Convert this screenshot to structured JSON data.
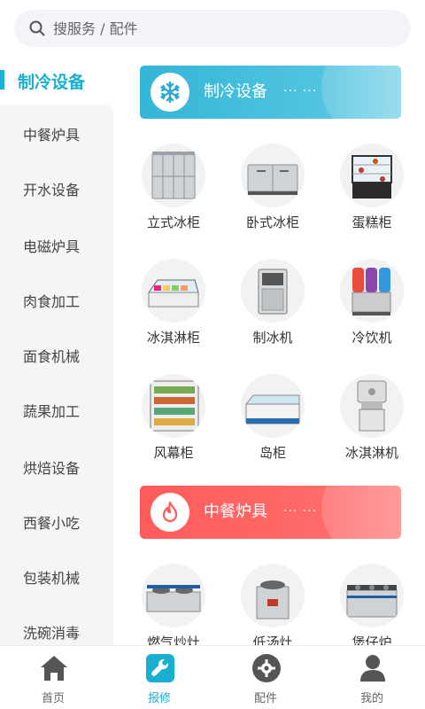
{
  "search": {
    "placeholder": "搜服务 / 配件",
    "icon": "search-icon"
  },
  "sidebar": {
    "active": "制冷设备",
    "accent_color": "#1aaed0",
    "items": [
      {
        "label": "中餐炉具"
      },
      {
        "label": "开水设备"
      },
      {
        "label": "电磁炉具"
      },
      {
        "label": "肉食加工"
      },
      {
        "label": "面食机械"
      },
      {
        "label": "蔬果加工"
      },
      {
        "label": "烘焙设备"
      },
      {
        "label": "西餐小吃"
      },
      {
        "label": "包装机械"
      },
      {
        "label": "洗碗消毒"
      }
    ]
  },
  "sections": [
    {
      "title": "制冷设备",
      "more": "··· ···",
      "icon": "snowflake-icon",
      "color": "#33b6d8",
      "products": [
        {
          "label": "立式冰柜",
          "icon": "upright-freezer-icon"
        },
        {
          "label": "卧式冰柜",
          "icon": "undercounter-freezer-icon"
        },
        {
          "label": "蛋糕柜",
          "icon": "cake-display-icon"
        },
        {
          "label": "冰淇淋柜",
          "icon": "ice-cream-display-icon"
        },
        {
          "label": "制冰机",
          "icon": "ice-maker-icon"
        },
        {
          "label": "冷饮机",
          "icon": "drink-dispenser-icon"
        },
        {
          "label": "风幕柜",
          "icon": "air-curtain-cabinet-icon"
        },
        {
          "label": "岛柜",
          "icon": "island-freezer-icon"
        },
        {
          "label": "冰淇淋机",
          "icon": "soft-serve-machine-icon"
        }
      ]
    },
    {
      "title": "中餐炉具",
      "more": "··· ···",
      "icon": "flame-icon",
      "color": "#ff5b5b",
      "products": [
        {
          "label": "燃气炒灶",
          "icon": "gas-wok-stove-icon"
        },
        {
          "label": "低汤灶",
          "icon": "soup-stove-icon"
        },
        {
          "label": "煲仔炉",
          "icon": "clay-pot-stove-icon"
        }
      ]
    }
  ],
  "tabbar": {
    "active_color": "#1aaed0",
    "items": [
      {
        "label": "首页",
        "icon": "home-icon"
      },
      {
        "label": "报修",
        "icon": "wrench-icon"
      },
      {
        "label": "配件",
        "icon": "gear-icon"
      },
      {
        "label": "我的",
        "icon": "user-icon"
      }
    ]
  }
}
